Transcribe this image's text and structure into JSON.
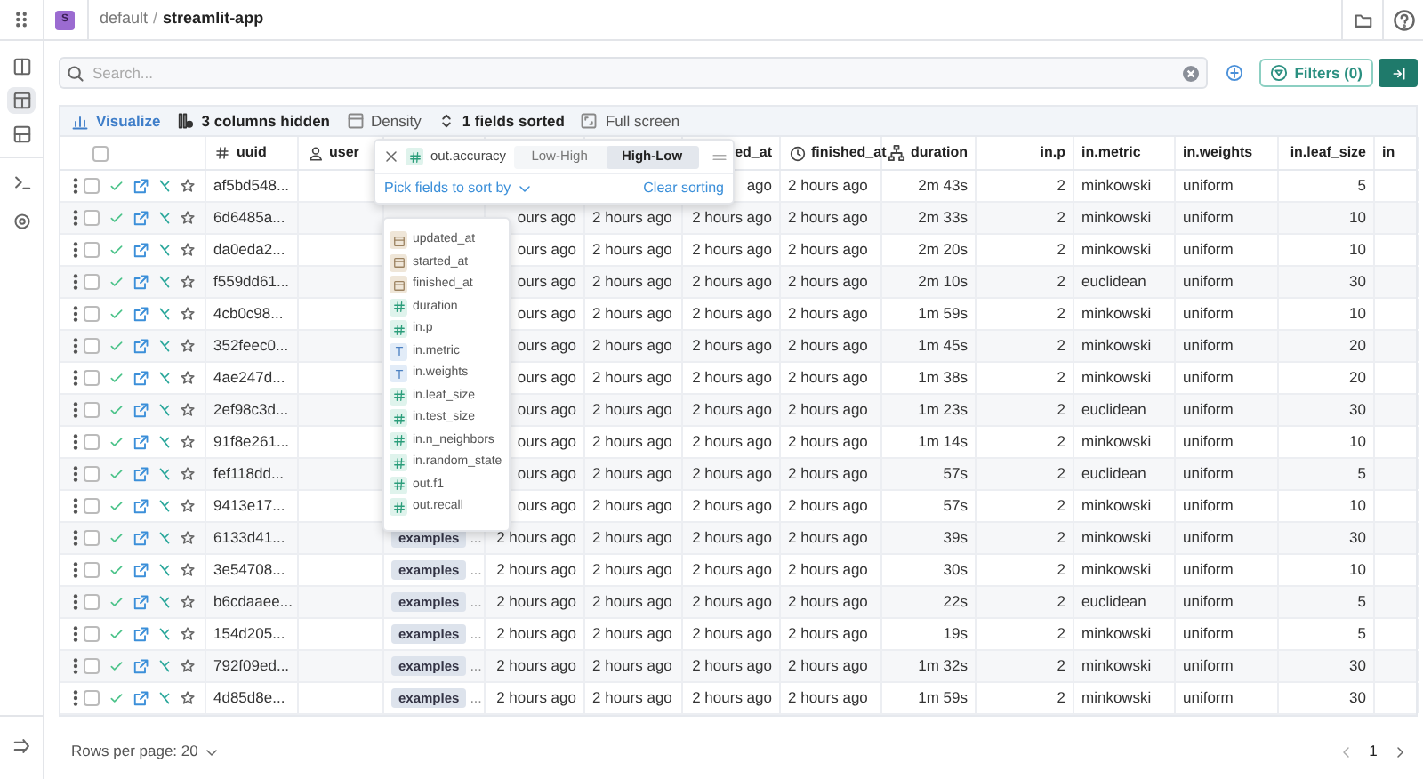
{
  "breadcrumb": {
    "avatar": "S",
    "workspace": "default",
    "separator": "/",
    "project": "streamlit-app"
  },
  "search": {
    "placeholder": "Search..."
  },
  "filters_button": "Filters (0)",
  "toolbar": [
    {
      "label": "Visualize",
      "kind": "visualize"
    },
    {
      "label": "3 columns hidden",
      "kind": "hidden"
    },
    {
      "label": "Density",
      "kind": "density"
    },
    {
      "label": "1 fields sorted",
      "kind": "sort"
    },
    {
      "label": "Full screen",
      "kind": "fullscreen"
    }
  ],
  "select_all_checked": false,
  "header": {
    "uuid": "uuid",
    "user": "user",
    "started_at": "ed_at",
    "finished_at": "finished_at",
    "duration": "duration",
    "in_p": "in.p",
    "in_metric": "in.metric",
    "in_weights": "in.weights",
    "in_leaf_size": "in.leaf_size",
    "column_14": "in"
  },
  "rows": [
    {
      "selected": false,
      "starred": false,
      "uuid": "af5bd548...",
      "started_at": "ago",
      "finished_at": "2 hours ago",
      "duration": "2m 43s",
      "in_p": "2",
      "in_metric": "minkowski",
      "in_weights": "uniform",
      "in_leaf_size": "5"
    },
    {
      "selected": false,
      "starred": false,
      "uuid": "6d6485a...",
      "created_at": "ours ago",
      "updated_at": "2 hours ago",
      "started_at": "2 hours ago",
      "finished_at": "2 hours ago",
      "duration": "2m 33s",
      "in_p": "2",
      "in_metric": "minkowski",
      "in_weights": "uniform",
      "in_leaf_size": "10"
    },
    {
      "selected": false,
      "starred": false,
      "uuid": "da0eda2...",
      "created_at": "ours ago",
      "updated_at": "2 hours ago",
      "started_at": "2 hours ago",
      "finished_at": "2 hours ago",
      "duration": "2m 20s",
      "in_p": "2",
      "in_metric": "minkowski",
      "in_weights": "uniform",
      "in_leaf_size": "10"
    },
    {
      "selected": false,
      "starred": false,
      "uuid": "f559dd61...",
      "created_at": "ours ago",
      "updated_at": "2 hours ago",
      "started_at": "2 hours ago",
      "finished_at": "2 hours ago",
      "duration": "2m 10s",
      "in_p": "2",
      "in_metric": "euclidean",
      "in_weights": "uniform",
      "in_leaf_size": "30"
    },
    {
      "selected": false,
      "starred": false,
      "uuid": "4cb0c98...",
      "created_at": "ours ago",
      "updated_at": "2 hours ago",
      "started_at": "2 hours ago",
      "finished_at": "2 hours ago",
      "duration": "1m 59s",
      "in_p": "2",
      "in_metric": "minkowski",
      "in_weights": "uniform",
      "in_leaf_size": "10"
    },
    {
      "selected": false,
      "starred": false,
      "uuid": "352feec0...",
      "created_at": "ours ago",
      "updated_at": "2 hours ago",
      "started_at": "2 hours ago",
      "finished_at": "2 hours ago",
      "duration": "1m 45s",
      "in_p": "2",
      "in_metric": "minkowski",
      "in_weights": "uniform",
      "in_leaf_size": "20"
    },
    {
      "selected": false,
      "starred": false,
      "uuid": "4ae247d...",
      "created_at": "ours ago",
      "updated_at": "2 hours ago",
      "started_at": "2 hours ago",
      "finished_at": "2 hours ago",
      "duration": "1m 38s",
      "in_p": "2",
      "in_metric": "minkowski",
      "in_weights": "uniform",
      "in_leaf_size": "20"
    },
    {
      "selected": false,
      "starred": false,
      "uuid": "2ef98c3d...",
      "created_at": "ours ago",
      "updated_at": "2 hours ago",
      "started_at": "2 hours ago",
      "finished_at": "2 hours ago",
      "duration": "1m 23s",
      "in_p": "2",
      "in_metric": "euclidean",
      "in_weights": "uniform",
      "in_leaf_size": "30"
    },
    {
      "selected": false,
      "starred": false,
      "uuid": "91f8e261...",
      "created_at": "ours ago",
      "updated_at": "2 hours ago",
      "started_at": "2 hours ago",
      "finished_at": "2 hours ago",
      "duration": "1m 14s",
      "in_p": "2",
      "in_metric": "minkowski",
      "in_weights": "uniform",
      "in_leaf_size": "10"
    },
    {
      "selected": false,
      "starred": false,
      "uuid": "fef118dd...",
      "created_at": "ours ago",
      "updated_at": "2 hours ago",
      "started_at": "2 hours ago",
      "finished_at": "2 hours ago",
      "duration": "57s",
      "in_p": "2",
      "in_metric": "euclidean",
      "in_weights": "uniform",
      "in_leaf_size": "5"
    },
    {
      "selected": false,
      "starred": false,
      "uuid": "9413e17...",
      "created_at": "ours ago",
      "updated_at": "2 hours ago",
      "started_at": "2 hours ago",
      "finished_at": "2 hours ago",
      "duration": "57s",
      "in_p": "2",
      "in_metric": "minkowski",
      "in_weights": "uniform",
      "in_leaf_size": "10"
    },
    {
      "selected": false,
      "starred": false,
      "uuid": "6133d41...",
      "tag": "examples",
      "tag_more": "...",
      "created_at": "2 hours ago",
      "updated_at": "2 hours ago",
      "started_at": "2 hours ago",
      "finished_at": "2 hours ago",
      "duration": "39s",
      "in_p": "2",
      "in_metric": "minkowski",
      "in_weights": "uniform",
      "in_leaf_size": "30"
    },
    {
      "selected": false,
      "starred": false,
      "uuid": "3e54708...",
      "tag": "examples",
      "tag_more": "...",
      "created_at": "2 hours ago",
      "updated_at": "2 hours ago",
      "started_at": "2 hours ago",
      "finished_at": "2 hours ago",
      "duration": "30s",
      "in_p": "2",
      "in_metric": "minkowski",
      "in_weights": "uniform",
      "in_leaf_size": "10"
    },
    {
      "selected": false,
      "starred": false,
      "uuid": "b6cdaaee...",
      "tag": "examples",
      "tag_more": "...",
      "created_at": "2 hours ago",
      "updated_at": "2 hours ago",
      "started_at": "2 hours ago",
      "finished_at": "2 hours ago",
      "duration": "22s",
      "in_p": "2",
      "in_metric": "euclidean",
      "in_weights": "uniform",
      "in_leaf_size": "5"
    },
    {
      "selected": false,
      "starred": false,
      "uuid": "154d205...",
      "tag": "examples",
      "tag_more": "...",
      "created_at": "2 hours ago",
      "updated_at": "2 hours ago",
      "started_at": "2 hours ago",
      "finished_at": "2 hours ago",
      "duration": "19s",
      "in_p": "2",
      "in_metric": "minkowski",
      "in_weights": "uniform",
      "in_leaf_size": "5"
    },
    {
      "selected": false,
      "starred": false,
      "uuid": "792f09ed...",
      "tag": "examples",
      "tag_more": "...",
      "created_at": "2 hours ago",
      "updated_at": "2 hours ago",
      "started_at": "2 hours ago",
      "finished_at": "2 hours ago",
      "duration": "1m 32s",
      "in_p": "2",
      "in_metric": "minkowski",
      "in_weights": "uniform",
      "in_leaf_size": "30"
    },
    {
      "selected": false,
      "starred": false,
      "uuid": "4d85d8e...",
      "tag": "examples",
      "tag_more": "...",
      "created_at": "2 hours ago",
      "updated_at": "2 hours ago",
      "started_at": "2 hours ago",
      "finished_at": "2 hours ago",
      "duration": "1m 59s",
      "in_p": "2",
      "in_metric": "minkowski",
      "in_weights": "uniform",
      "in_leaf_size": "30"
    }
  ],
  "sort_popup": {
    "field": {
      "label": "out.accuracy",
      "kind": "number"
    },
    "orders": [
      {
        "label": "Low-High",
        "selected": false
      },
      {
        "label": "High-Low",
        "selected": true
      }
    ],
    "pick_label": "Pick fields to sort by",
    "clear_label": "Clear sorting"
  },
  "field_menu": [
    {
      "label": "updated_at",
      "kind": "date"
    },
    {
      "label": "started_at",
      "kind": "date"
    },
    {
      "label": "finished_at",
      "kind": "date"
    },
    {
      "label": "duration",
      "kind": "number"
    },
    {
      "label": "in.p",
      "kind": "number"
    },
    {
      "label": "in.metric",
      "kind": "text"
    },
    {
      "label": "in.weights",
      "kind": "text"
    },
    {
      "label": "in.leaf_size",
      "kind": "number"
    },
    {
      "label": "in.test_size",
      "kind": "number"
    },
    {
      "label": "in.n_neighbors",
      "kind": "number"
    },
    {
      "label": "in.random_state",
      "kind": "number"
    },
    {
      "label": "out.f1",
      "kind": "number"
    },
    {
      "label": "out.recall",
      "kind": "number"
    }
  ],
  "footer": {
    "rows_per_page": "Rows per page: 20",
    "page": "1"
  }
}
